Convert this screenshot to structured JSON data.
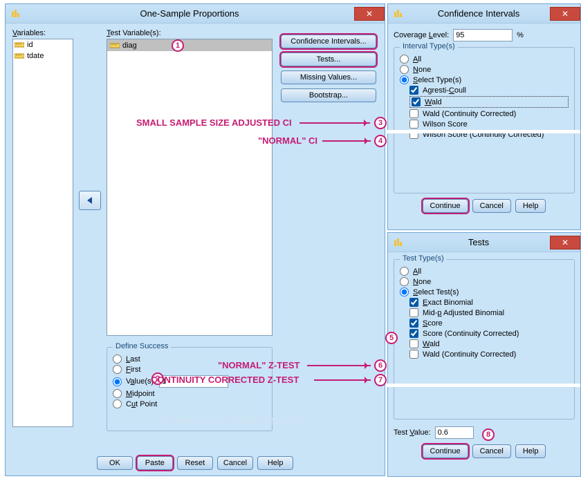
{
  "main": {
    "title": "One-Sample Proportions",
    "variables_label": "Variables:",
    "variables": [
      {
        "icon": "ruler",
        "name": "id"
      },
      {
        "icon": "ruler",
        "name": "tdate"
      }
    ],
    "test_vars_label": "Test Variable(s):",
    "test_vars": [
      {
        "icon": "ruler",
        "name": "diag"
      }
    ],
    "side_buttons": {
      "ci": "Confidence Intervals...",
      "tests": "Tests...",
      "missing": "Missing Values...",
      "bootstrap": "Bootstrap..."
    },
    "define_success": {
      "legend": "Define Success",
      "options": {
        "last": "Last",
        "first": "First",
        "values": "Value(s)",
        "midpoint": "Midpoint",
        "cutpoint": "Cut Point"
      },
      "value_input": "1"
    },
    "footer": {
      "ok": "OK",
      "paste": "Paste",
      "reset": "Reset",
      "cancel": "Cancel",
      "help": "Help"
    }
  },
  "ci": {
    "title": "Confidence Intervals",
    "coverage_label": "Coverage Level:",
    "coverage_value": "95",
    "pct": "%",
    "legend": "Interval Type(s)",
    "radios": {
      "all": "All",
      "none": "None",
      "select": "Select Type(s)"
    },
    "checks": {
      "agresti": "Agresti-Coull",
      "wald": "Wald",
      "wald_cc": "Wald (Continuity Corrected)",
      "wilson": "Wilson Score",
      "wilson_cc": "Wilson Score (Continuity Corrected)"
    },
    "footer": {
      "continue": "Continue",
      "cancel": "Cancel",
      "help": "Help"
    }
  },
  "tests": {
    "title": "Tests",
    "legend": "Test Type(s)",
    "radios": {
      "all": "All",
      "none": "None",
      "select": "Select Test(s)"
    },
    "checks": {
      "exact": "Exact Binomial",
      "midp": "Mid-p Adjusted Binomial",
      "score": "Score",
      "score_cc": "Score (Continuity Corrected)",
      "wald": "Wald",
      "wald_cc": "Wald (Continuity Corrected)"
    },
    "test_value_label": "Test Value:",
    "test_value": "0.6",
    "footer": {
      "continue": "Continue",
      "cancel": "Cancel",
      "help": "Help"
    }
  },
  "annotations": {
    "a1": "1",
    "a2": "2",
    "a3": "3",
    "a4": "4",
    "a5": "5",
    "a6": "6",
    "a7": "7",
    "a8": "8",
    "small_ci": "SMALL SAMPLE SIZE ADJUSTED CI",
    "normal_ci": "\"NORMAL\" CI",
    "normal_z": "\"NORMAL\" Z-TEST",
    "cc_z": "CONTINUITY CORRECTED Z-TEST"
  },
  "watermark": "© www.spss-tutorials.com"
}
